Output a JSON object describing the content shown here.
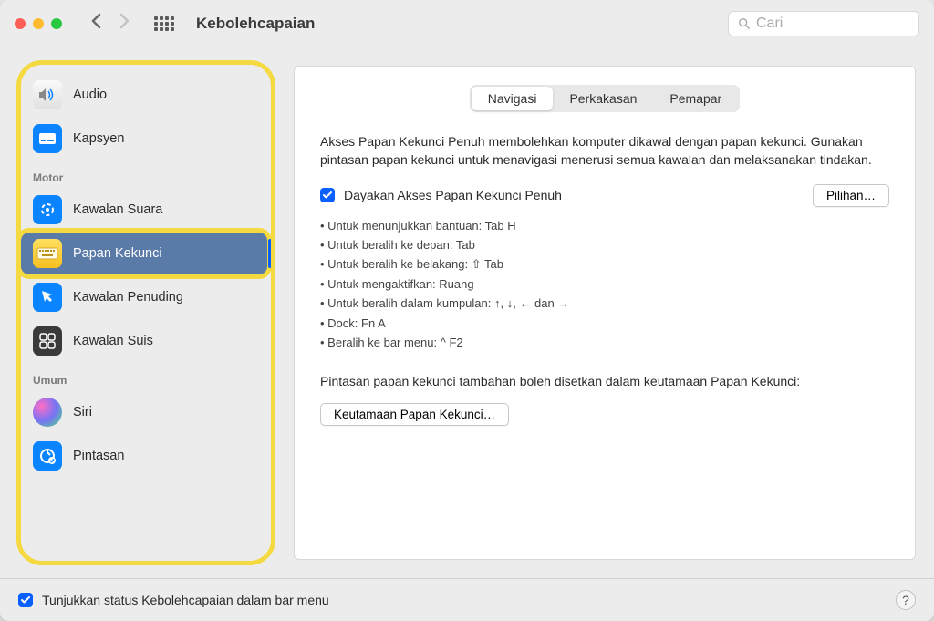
{
  "window": {
    "title": "Kebolehcapaian",
    "search_placeholder": "Cari"
  },
  "sidebar": {
    "items": [
      {
        "label": "Audio",
        "icon": "audio"
      },
      {
        "label": "Kapsyen",
        "icon": "captions"
      }
    ],
    "motor_section": "Motor",
    "motor_items": [
      {
        "label": "Kawalan Suara",
        "icon": "voice"
      },
      {
        "label": "Papan Kekunci",
        "icon": "keyboard",
        "selected": true
      },
      {
        "label": "Kawalan Penuding",
        "icon": "pointer"
      },
      {
        "label": "Kawalan Suis",
        "icon": "switch"
      }
    ],
    "general_section": "Umum",
    "general_items": [
      {
        "label": "Siri",
        "icon": "siri"
      },
      {
        "label": "Pintasan",
        "icon": "shortcut"
      }
    ]
  },
  "tabs": {
    "navigation": "Navigasi",
    "hardware": "Perkakasan",
    "viewer": "Pemapar"
  },
  "panel": {
    "description": "Akses Papan Kekunci Penuh membolehkan komputer dikawal dengan papan kekunci. Gunakan pintasan papan kekunci untuk menavigasi menerusi semua kawalan dan melaksanakan tindakan.",
    "enable_label": "Dayakan Akses Papan Kekunci Penuh",
    "options_button": "Pilihan…",
    "help_lines": [
      "• Untuk menunjukkan bantuan: Tab H",
      "• Untuk beralih ke depan: Tab",
      "• Untuk beralih ke belakang: ⇧ Tab",
      "• Untuk mengaktifkan: Ruang",
      "• Untuk beralih dalam kumpulan: ↑, ↓, ← dan →",
      "• Dock: Fn A",
      "• Beralih ke bar menu: ^ F2"
    ],
    "additional_text": "Pintasan papan kekunci tambahan boleh disetkan dalam keutamaan Papan Kekunci:",
    "prefs_button": "Keutamaan Papan Kekunci…"
  },
  "footer": {
    "status_label": "Tunjukkan status Kebolehcapaian dalam bar menu"
  }
}
